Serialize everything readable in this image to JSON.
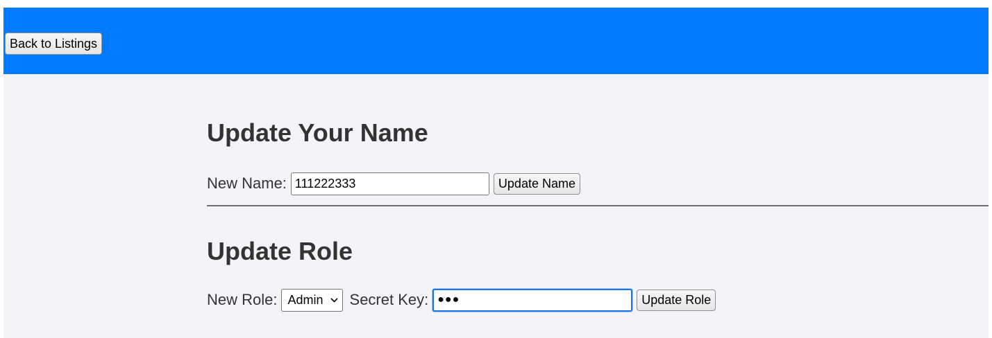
{
  "header": {
    "back_label": "Back to Listings",
    "bar_color": "#007bff"
  },
  "name_section": {
    "title": "Update Your Name",
    "label": "New Name:",
    "value": "111222333",
    "button_label": "Update Name"
  },
  "role_section": {
    "title": "Update Role",
    "role_label": "New Role:",
    "role_selected": "Admin",
    "secret_label": "Secret Key:",
    "secret_value": "●●●",
    "button_label": "Update Role"
  },
  "icons": {
    "select_chevron": "chevron-down-icon"
  }
}
